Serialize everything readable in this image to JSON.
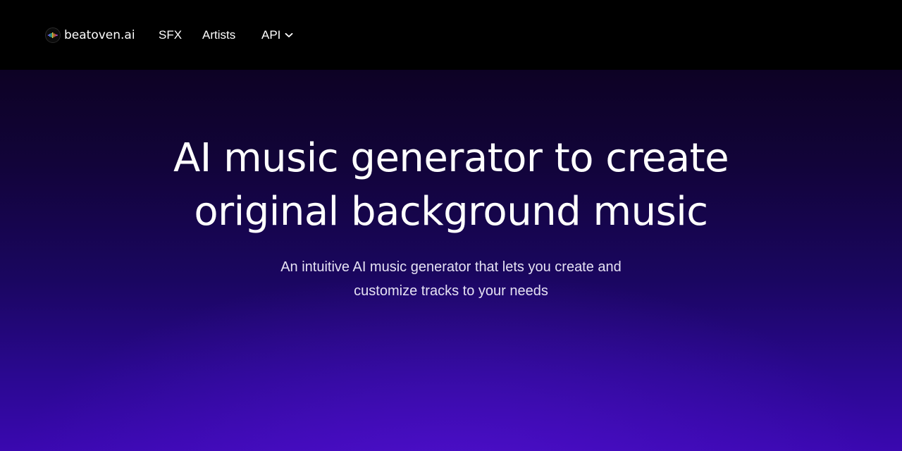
{
  "header": {
    "brand": {
      "logo_icon": "waveform-logo-icon",
      "name": "beatoven.ai"
    },
    "nav": {
      "sfx": "SFX",
      "artists": "Artists",
      "api": "API",
      "api_icon": "chevron-down-icon"
    }
  },
  "hero": {
    "title_line1": "AI music generator to create",
    "title_line2": "original background music",
    "subtitle_line1": "An intuitive AI music generator that lets you create and",
    "subtitle_line2": "customize tracks to your needs"
  },
  "colors": {
    "nav_background": "#000000",
    "hero_top": "#0d0224",
    "hero_bottom": "#3a08b0",
    "text_primary": "#ffffff"
  }
}
